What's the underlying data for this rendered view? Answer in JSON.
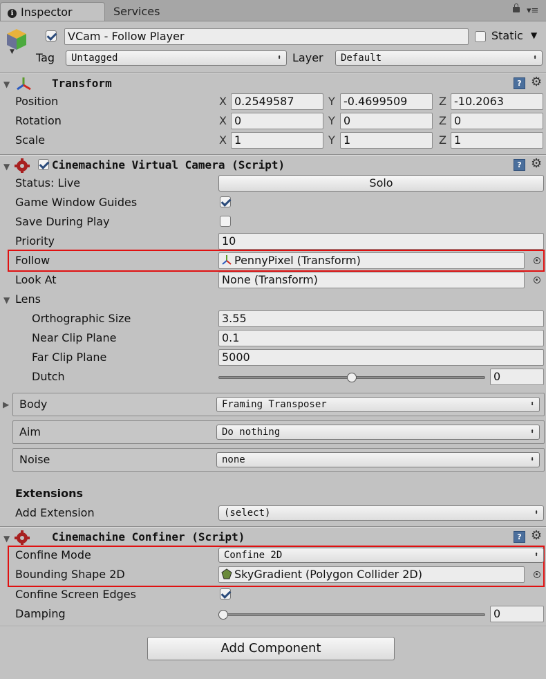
{
  "tabs": {
    "inspector": "Inspector",
    "services": "Services"
  },
  "object": {
    "name": "VCam - Follow Player",
    "static_label": "Static",
    "tag_label": "Tag",
    "tag_value": "Untagged",
    "layer_label": "Layer",
    "layer_value": "Default"
  },
  "transform": {
    "title": "Transform",
    "position": {
      "label": "Position",
      "x": "0.2549587",
      "y": "-0.4699509",
      "z": "-10.2063"
    },
    "rotation": {
      "label": "Rotation",
      "x": "0",
      "y": "0",
      "z": "0"
    },
    "scale": {
      "label": "Scale",
      "x": "1",
      "y": "1",
      "z": "1"
    },
    "axis": {
      "x": "X",
      "y": "Y",
      "z": "Z"
    }
  },
  "vcam": {
    "title": "Cinemachine Virtual Camera (Script)",
    "status_label": "Status: Live",
    "solo_label": "Solo",
    "guides_label": "Game Window Guides",
    "save_label": "Save During Play",
    "priority_label": "Priority",
    "priority_value": "10",
    "follow_label": "Follow",
    "follow_value": "PennyPixel (Transform)",
    "lookat_label": "Look At",
    "lookat_value": "None (Transform)",
    "lens_label": "Lens",
    "ortho_label": "Orthographic Size",
    "ortho_value": "3.55",
    "near_label": "Near Clip Plane",
    "near_value": "0.1",
    "far_label": "Far Clip Plane",
    "far_value": "5000",
    "dutch_label": "Dutch",
    "dutch_value": "0",
    "dutch_fraction": 0.5,
    "body_label": "Body",
    "body_value": "Framing Transposer",
    "aim_label": "Aim",
    "aim_value": "Do nothing",
    "noise_label": "Noise",
    "noise_value": "none",
    "extensions_label": "Extensions",
    "add_ext_label": "Add Extension",
    "add_ext_value": "(select)"
  },
  "confiner": {
    "title": "Cinemachine Confiner (Script)",
    "mode_label": "Confine Mode",
    "mode_value": "Confine 2D",
    "shape_label": "Bounding Shape 2D",
    "shape_value": "SkyGradient (Polygon Collider 2D)",
    "edges_label": "Confine Screen Edges",
    "damping_label": "Damping",
    "damping_value": "0",
    "damping_fraction": 0.0
  },
  "add_component_label": "Add Component",
  "colors": {
    "highlight": "#e01010",
    "panel": "#c2c2c2"
  }
}
